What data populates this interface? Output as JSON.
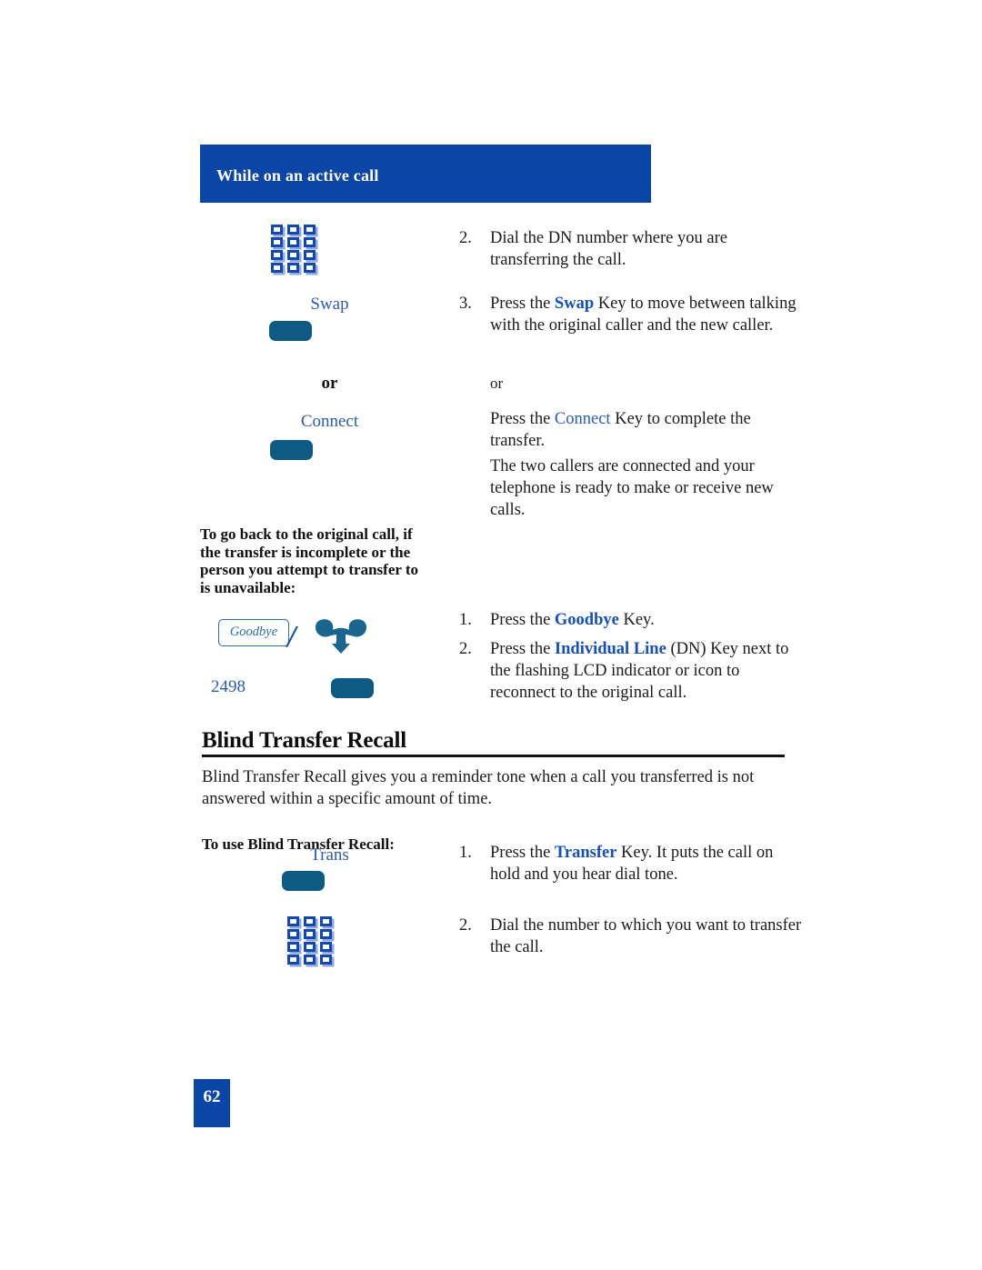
{
  "page": {
    "number": "62",
    "section_header": "While on an active call"
  },
  "section_one": {
    "steps": [
      {
        "num": "2.",
        "pre": "Dial the DN number where you are transferring the call.",
        "icon": "keypad-icon"
      },
      {
        "num": "3.",
        "pre": "Press the ",
        "keyword": "Swap",
        "post": " Key to move between talking with the original caller and the new caller.",
        "key_label": "Swap"
      }
    ],
    "or_left": "or",
    "or_right": "or",
    "connect_key_label": "Connect",
    "connect_text_pre": "Press the ",
    "connect_keyword": "Connect",
    "connect_text_post": " Key to complete the transfer.",
    "result_text": "The two callers are connected and your telephone is ready to make or receive new calls."
  },
  "note": {
    "text": "To go back to the original call, if the transfer is incomplete or the person you attempt to transfer to is unavailable:"
  },
  "goodbye_block": {
    "goodbye_key_text": "Goodbye",
    "separator": "/",
    "dn_number": "2498",
    "steps": [
      {
        "num": "1.",
        "pre": "Press the ",
        "keyword": "Goodbye",
        "post": " Key."
      },
      {
        "num": "2.",
        "pre": "Press the ",
        "keyword": "Individual Line",
        "post": " (DN) Key next to the flashing LCD indicator or icon to reconnect to the original call."
      }
    ]
  },
  "blind_transfer": {
    "heading": "Blind Transfer Recall",
    "intro": "Blind Transfer Recall gives you a reminder tone when a call you transferred is not answered within a specific amount of time.",
    "subheading": "To use Blind Transfer Recall:",
    "trans_key_label": "Trans",
    "steps": [
      {
        "num": "1.",
        "pre": "Press the ",
        "keyword": "Transfer",
        "post": " Key. It puts the call on hold and you hear dial tone."
      },
      {
        "num": "2.",
        "pre": "Dial the number to which you want to transfer the call.",
        "keyword": "",
        "post": ""
      }
    ]
  },
  "colors": {
    "header_blue": "#0b45a6",
    "keyword_blue": "#1450bb",
    "label_blue": "#2a5bbd",
    "softkey_teal": "#0d5a85",
    "handset_teal": "#1a6590"
  }
}
